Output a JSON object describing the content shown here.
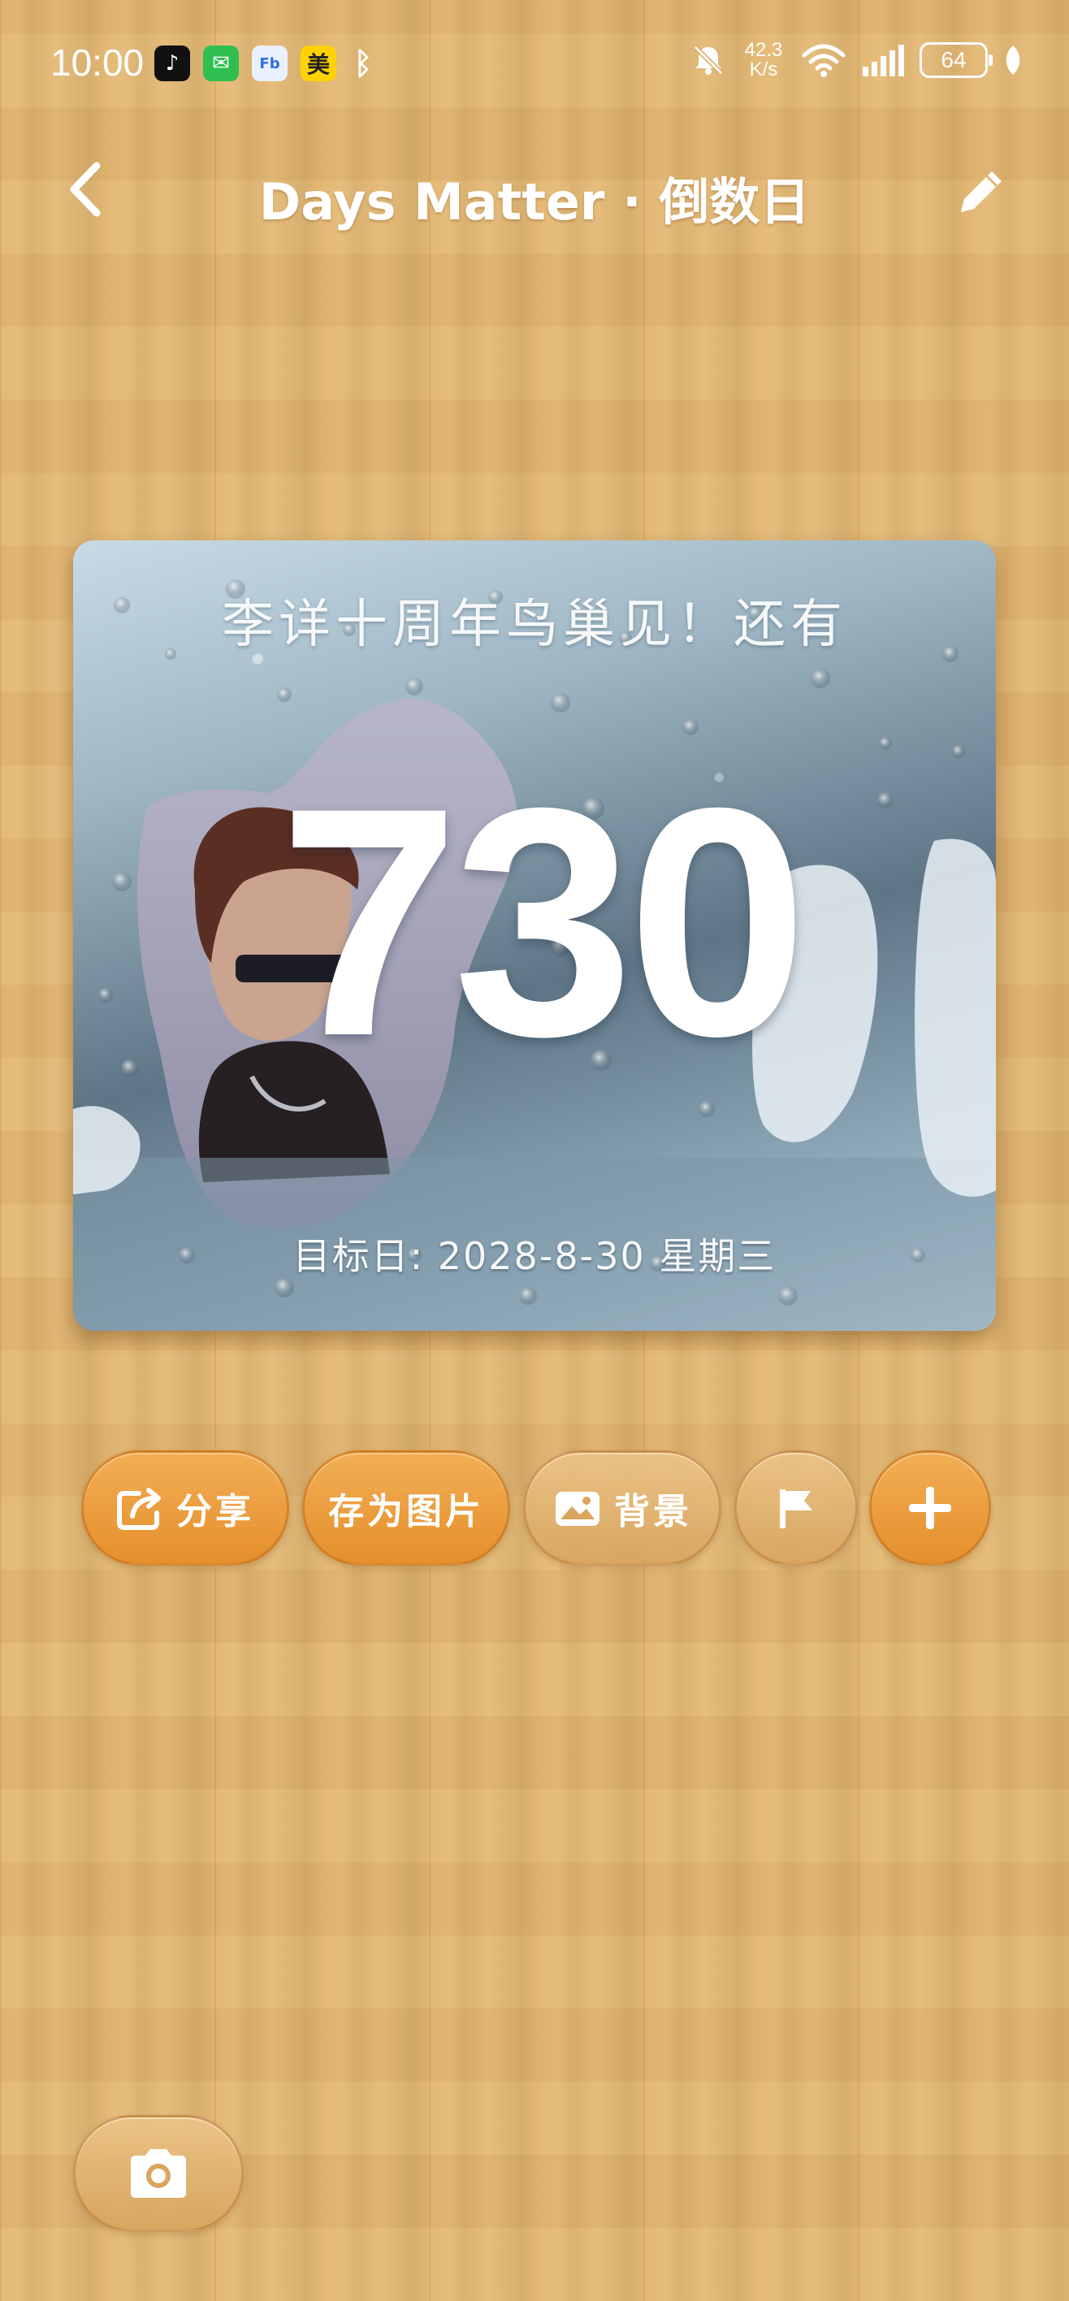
{
  "status_bar": {
    "time": "10:00",
    "app_icons": [
      {
        "name": "tiktok-icon",
        "glyph": "♪"
      },
      {
        "name": "wechat-icon",
        "glyph": "✉"
      },
      {
        "name": "fb-icon",
        "glyph": "Fb"
      },
      {
        "name": "meituan-icon",
        "glyph": "美"
      },
      {
        "name": "bluetooth-icon",
        "glyph": "ᛒ"
      }
    ],
    "net_speed_value": "42.3",
    "net_speed_unit": "K/s",
    "battery_level": "64"
  },
  "header": {
    "title": "Days Matter · 倒数日"
  },
  "card": {
    "title": "李详十周年鸟巢见！还有",
    "days": "730",
    "target_date": "目标日: 2028-8-30 星期三"
  },
  "actions": {
    "share_label": "分享",
    "save_image_label": "存为图片",
    "background_label": "背景"
  },
  "colors": {
    "accent_orange": "#e99a3a",
    "wood": "#e2b671",
    "text_white": "#ffffff"
  }
}
